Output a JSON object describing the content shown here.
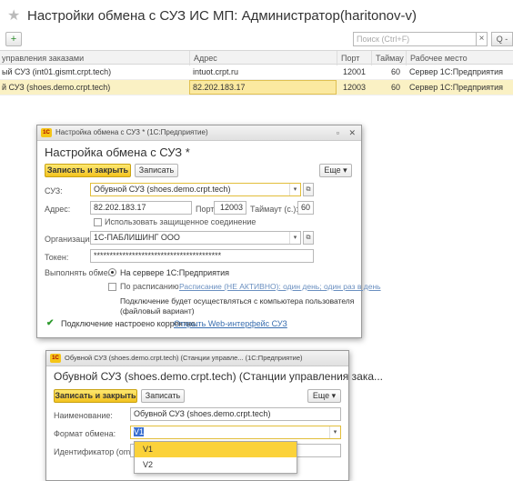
{
  "page": {
    "title": "Настройки обмена с СУЗ ИС МП: Администратор(haritonov-v)",
    "search_placeholder": "Поиск (Ctrl+F)",
    "search_btn": "Q -",
    "add_icon": "+",
    "star_icon": "★"
  },
  "grid": {
    "columns": [
      "управления заказами",
      "Адрес",
      "Порт",
      "Таймаут",
      "Рабочее место"
    ],
    "rows": [
      {
        "name": "ый СУЗ (int01.gismt.crpt.tech)",
        "address": "intuot.crpt.ru",
        "port": "12001",
        "timeout": "60",
        "workplace": "Сервер 1С:Предприятия"
      },
      {
        "name": "й СУЗ (shoes.demo.crpt.tech)",
        "address": "82.202.183.17",
        "port": "12003",
        "timeout": "60",
        "workplace": "Сервер 1С:Предприятия"
      }
    ]
  },
  "win1": {
    "titlebar": "Настройка обмена с СУЗ *  (1С:Предприятие)",
    "title": "Настройка обмена с СУЗ *",
    "save_close": "Записать и закрыть",
    "save": "Записать",
    "more": "Еще ▾",
    "suz_label": "СУЗ:",
    "suz_value": "Обувной СУЗ (shoes.demo.crpt.tech)",
    "address_label": "Адрес:",
    "address_value": "82.202.183.17",
    "port_label": "Порт:",
    "port_value": "12003",
    "timeout_label": "Таймаут (с.):",
    "timeout_value": "60",
    "secure_label": "Использовать защищенное соединение",
    "org_label": "Организация:",
    "org_value": "1С-ПАБЛИШИНГ ООО",
    "token_label": "Токен:",
    "token_value": "****************************************",
    "exchange_label": "Выполнять обмен:",
    "on_server": "На сервере 1С:Предприятия",
    "by_schedule": "По расписанию",
    "schedule_link": "Расписание (НЕ АКТИВНО): один день; один раз в день",
    "note_line1": "Подключение будет осуществляться с компьютера пользователя",
    "note_line2": "(файловый вариант)",
    "status_text": "Подключение настроено корректно.",
    "web_link": "Открыть Web-интерфейс СУЗ"
  },
  "win2": {
    "titlebar": "Обувной СУЗ (shoes.demo.crpt.tech) (Станции управле...  (1С:Предприятие)",
    "title": "Обувной СУЗ (shoes.demo.crpt.tech) (Станции управления зака...",
    "save_close": "Записать и закрыть",
    "save": "Записать",
    "more": "Еще ▾",
    "name_label": "Наименование:",
    "name_value": "Обувной СУЗ (shoes.demo.crpt.tech)",
    "format_label": "Формат обмена:",
    "format_value": "V1",
    "id_label": "Идентификатор (omsId):",
    "options": [
      "V1",
      "V2"
    ]
  }
}
